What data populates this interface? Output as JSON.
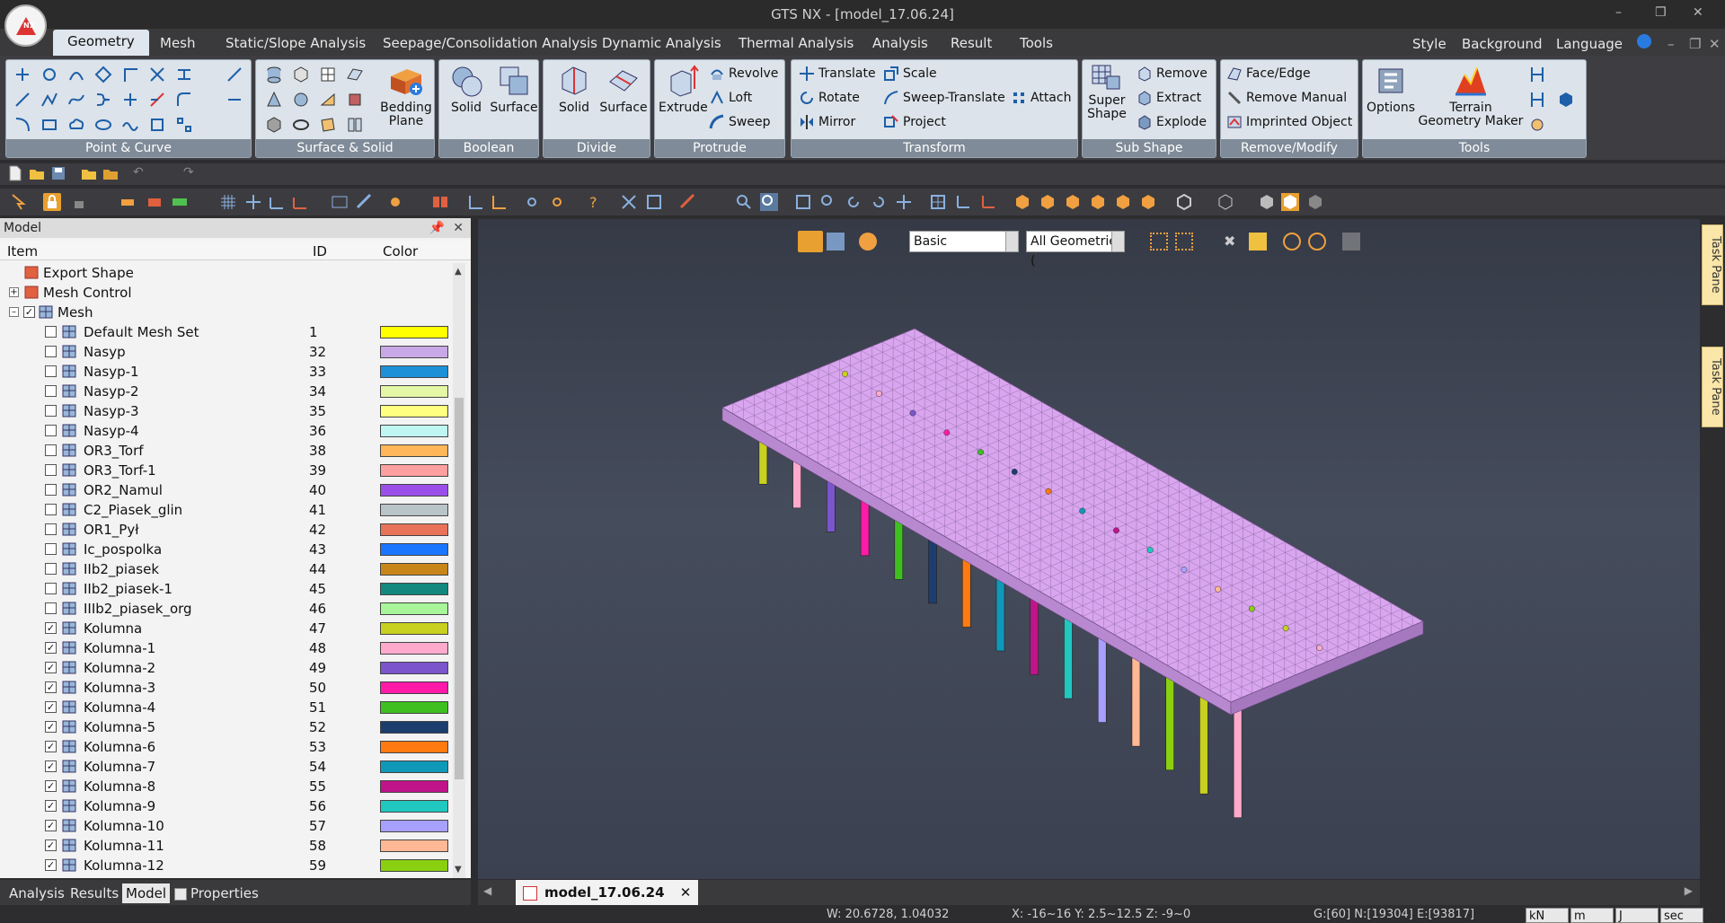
{
  "window": {
    "title": "GTS NX - [model_17.06.24]"
  },
  "menu": {
    "tabs": [
      "Geometry",
      "Mesh",
      "Static/Slope Analysis",
      "Seepage/Consolidation Analysis",
      "Dynamic Analysis",
      "Thermal Analysis",
      "Analysis",
      "Result",
      "Tools"
    ],
    "right": [
      "Style",
      "Background",
      "Language"
    ]
  },
  "ribbon": {
    "groups": [
      "Point & Curve",
      "Surface & Solid",
      "Boolean",
      "Divide",
      "Protrude",
      "Transform",
      "Sub Shape",
      "Remove/Modify",
      "Tools"
    ],
    "bedding_plane": "Bedding Plane",
    "bool_solid": "Solid",
    "bool_surface": "Surface",
    "div_solid": "Solid",
    "div_surface": "Surface",
    "extrude": "Extrude",
    "revolve": "Revolve",
    "loft": "Loft",
    "sweep": "Sweep",
    "translate": "Translate",
    "rotate": "Rotate",
    "mirror": "Mirror",
    "scale": "Scale",
    "sweep_translate": "Sweep-Translate",
    "project": "Project",
    "attach": "Attach",
    "super_shape": "Super Shape",
    "remove": "Remove",
    "extract": "Extract",
    "explode": "Explode",
    "face_edge": "Face/Edge",
    "remove_manual": "Remove Manual",
    "imprinted_object": "Imprinted Object",
    "options": "Options",
    "terrain": "Terrain Geometry Maker"
  },
  "panel": {
    "title": "Model",
    "columns": {
      "item": "Item",
      "id": "ID",
      "color": "Color"
    },
    "rows": [
      {
        "label": "Export Shape",
        "level": 0,
        "expander": "",
        "check": "none",
        "id": "",
        "color": ""
      },
      {
        "label": "Mesh Control",
        "level": 0,
        "expander": "+",
        "check": "none",
        "id": "",
        "color": ""
      },
      {
        "label": "Mesh",
        "level": 0,
        "expander": "-",
        "check": "checked",
        "id": "",
        "color": ""
      },
      {
        "label": "Default Mesh Set",
        "level": 1,
        "check": "unchecked",
        "id": "1",
        "color": "#ffff00"
      },
      {
        "label": "Nasyp",
        "level": 1,
        "check": "unchecked",
        "id": "32",
        "color": "#c9a8e8"
      },
      {
        "label": "Nasyp-1",
        "level": 1,
        "check": "unchecked",
        "id": "33",
        "color": "#1e90d8"
      },
      {
        "label": "Nasyp-2",
        "level": 1,
        "check": "unchecked",
        "id": "34",
        "color": "#e4f7a6"
      },
      {
        "label": "Nasyp-3",
        "level": 1,
        "check": "unchecked",
        "id": "35",
        "color": "#ffff80"
      },
      {
        "label": "Nasyp-4",
        "level": 1,
        "check": "unchecked",
        "id": "36",
        "color": "#bff5f2"
      },
      {
        "label": "OR3_Torf",
        "level": 1,
        "check": "unchecked",
        "id": "38",
        "color": "#ffb55a"
      },
      {
        "label": "OR3_Torf-1",
        "level": 1,
        "check": "unchecked",
        "id": "39",
        "color": "#ffa0a0"
      },
      {
        "label": "OR2_Namul",
        "level": 1,
        "check": "unchecked",
        "id": "40",
        "color": "#9b4fe8"
      },
      {
        "label": "C2_Piasek_glin",
        "level": 1,
        "check": "unchecked",
        "id": "41",
        "color": "#b8c4c8"
      },
      {
        "label": "OR1_Pył",
        "level": 1,
        "check": "unchecked",
        "id": "42",
        "color": "#e8735a"
      },
      {
        "label": "Ic_pospolka",
        "level": 1,
        "check": "unchecked",
        "id": "43",
        "color": "#1a75ff"
      },
      {
        "label": "IIb2_piasek",
        "level": 1,
        "check": "unchecked",
        "id": "44",
        "color": "#c8861a"
      },
      {
        "label": "IIb2_piasek-1",
        "level": 1,
        "check": "unchecked",
        "id": "45",
        "color": "#12887e"
      },
      {
        "label": "IIIb2_piasek_org",
        "level": 1,
        "check": "unchecked",
        "id": "46",
        "color": "#a8f59a"
      },
      {
        "label": "Kolumna",
        "level": 1,
        "check": "checked",
        "id": "47",
        "color": "#c8d020"
      },
      {
        "label": "Kolumna-1",
        "level": 1,
        "check": "checked",
        "id": "48",
        "color": "#ffaacc"
      },
      {
        "label": "Kolumna-2",
        "level": 1,
        "check": "checked",
        "id": "49",
        "color": "#7a55cc"
      },
      {
        "label": "Kolumna-3",
        "level": 1,
        "check": "checked",
        "id": "50",
        "color": "#ff1aa8"
      },
      {
        "label": "Kolumna-4",
        "level": 1,
        "check": "checked",
        "id": "51",
        "color": "#3fbf20"
      },
      {
        "label": "Kolumna-5",
        "level": 1,
        "check": "checked",
        "id": "52",
        "color": "#1c3d6e"
      },
      {
        "label": "Kolumna-6",
        "level": 1,
        "check": "checked",
        "id": "53",
        "color": "#ff7a10"
      },
      {
        "label": "Kolumna-7",
        "level": 1,
        "check": "checked",
        "id": "54",
        "color": "#1098b8"
      },
      {
        "label": "Kolumna-8",
        "level": 1,
        "check": "checked",
        "id": "55",
        "color": "#c0148a"
      },
      {
        "label": "Kolumna-9",
        "level": 1,
        "check": "checked",
        "id": "56",
        "color": "#20c8c0"
      },
      {
        "label": "Kolumna-10",
        "level": 1,
        "check": "checked",
        "id": "57",
        "color": "#a8a0ff"
      },
      {
        "label": "Kolumna-11",
        "level": 1,
        "check": "checked",
        "id": "58",
        "color": "#ffb896"
      },
      {
        "label": "Kolumna-12",
        "level": 1,
        "check": "checked",
        "id": "59",
        "color": "#8ad010"
      }
    ],
    "tabs": [
      "Analysis",
      "Results",
      "Model",
      "Properties"
    ],
    "active_tab": "Model"
  },
  "viewport": {
    "display_mode": "Basic",
    "filter": "All Geometries (",
    "doc_tab": "model_17.06.24",
    "mesh_color": "#d8a5ee"
  },
  "taskpane": {
    "label": "Task Pane"
  },
  "status": {
    "w": "W: 20.6728, 1.04032",
    "angles": "X: -16~16 Y: 2.5~12.5 Z: -9~0",
    "counts": "G:[60] N:[19304] E:[93817]",
    "units": [
      "kN",
      "m",
      "J",
      "sec"
    ]
  }
}
